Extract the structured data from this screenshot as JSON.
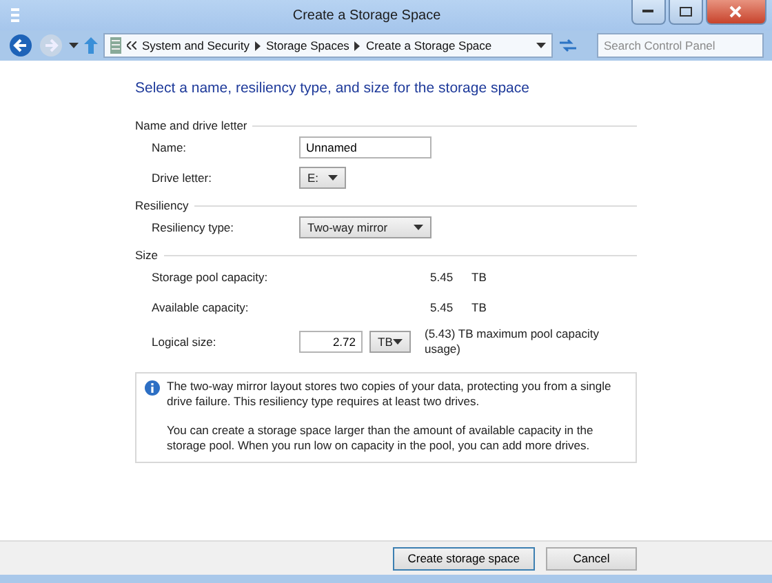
{
  "window": {
    "title": "Create a Storage Space"
  },
  "address_bar": {
    "breadcrumbs": [
      "System and Security",
      "Storage Spaces",
      "Create a Storage Space"
    ]
  },
  "search": {
    "placeholder": "Search Control Panel"
  },
  "heading": "Select a name, resiliency type, and size for the storage space",
  "sections": [
    {
      "title": "Name and drive letter",
      "rows": [
        {
          "kind": "text",
          "label": "Name:",
          "value": "Unnamed"
        },
        {
          "kind": "dropdown",
          "label": "Drive letter:",
          "value": "E:"
        }
      ]
    },
    {
      "title": "Resiliency",
      "rows": [
        {
          "kind": "dropdown",
          "label": "Resiliency type:",
          "value": "Two-way mirror"
        }
      ]
    },
    {
      "title": "Size",
      "rows": [
        {
          "kind": "reading",
          "label": "Storage pool capacity:",
          "value": "5.45",
          "unit": "TB"
        },
        {
          "kind": "reading",
          "label": "Available capacity:",
          "value": "5.45",
          "unit": "TB"
        },
        {
          "kind": "size",
          "label": "Logical size:",
          "value": "2.72",
          "unit": "TB",
          "note": "(5.43) TB maximum pool capacity usage)"
        }
      ]
    }
  ],
  "info": [
    "The two-way mirror layout stores two copies of your data, protecting you from a single drive failure. This resiliency type requires at least two drives.",
    "You can create a storage space larger than the amount of available capacity in the storage pool. When you run low on capacity in the pool, you can add more drives."
  ],
  "buttons": [
    {
      "label": "Create storage space",
      "default": true
    },
    {
      "label": "Cancel",
      "default": false
    }
  ]
}
